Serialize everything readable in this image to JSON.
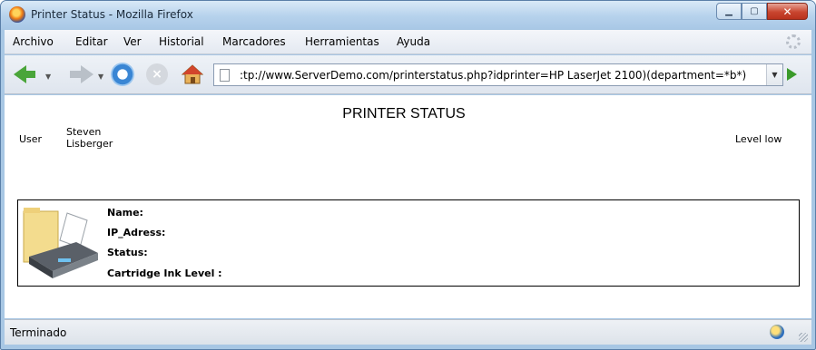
{
  "window": {
    "title": "Printer Status - Mozilla Firefox",
    "controls": {
      "minimize": "▁",
      "maximize": "▢",
      "close": "✕"
    }
  },
  "menubar": {
    "items": [
      "Archivo",
      "Editar",
      "Ver",
      "Historial",
      "Marcadores",
      "Herramientas",
      "Ayuda"
    ]
  },
  "navbar": {
    "url": ":tp://www.ServerDemo.com/printerstatus.php?idprinter=HP LaserJet 2100)(department=*b*)",
    "dropdown_glyph": "▼"
  },
  "page": {
    "title": "PRINTER STATUS",
    "user_label": "User",
    "user_name": "Steven Lisberger",
    "level_text": "Level low",
    "printer": {
      "fields": {
        "name": "Name:",
        "ip": "IP_Adress:",
        "status": "Status:",
        "ink": "Cartridge Ink Level :"
      }
    }
  },
  "statusbar": {
    "text": "Terminado"
  },
  "colors": {
    "title_bar": "#b6d2ec",
    "close_button": "#c9452f",
    "nav_back": "#4aa53a",
    "go_button": "#3a9a2a"
  },
  "icons": [
    "firefox-icon",
    "back-arrow-icon",
    "forward-arrow-icon",
    "reload-icon",
    "stop-icon",
    "home-icon",
    "page-icon",
    "go-arrow-icon",
    "printer-icon",
    "folder-icon",
    "status-globe-icon",
    "throbber-icon"
  ]
}
